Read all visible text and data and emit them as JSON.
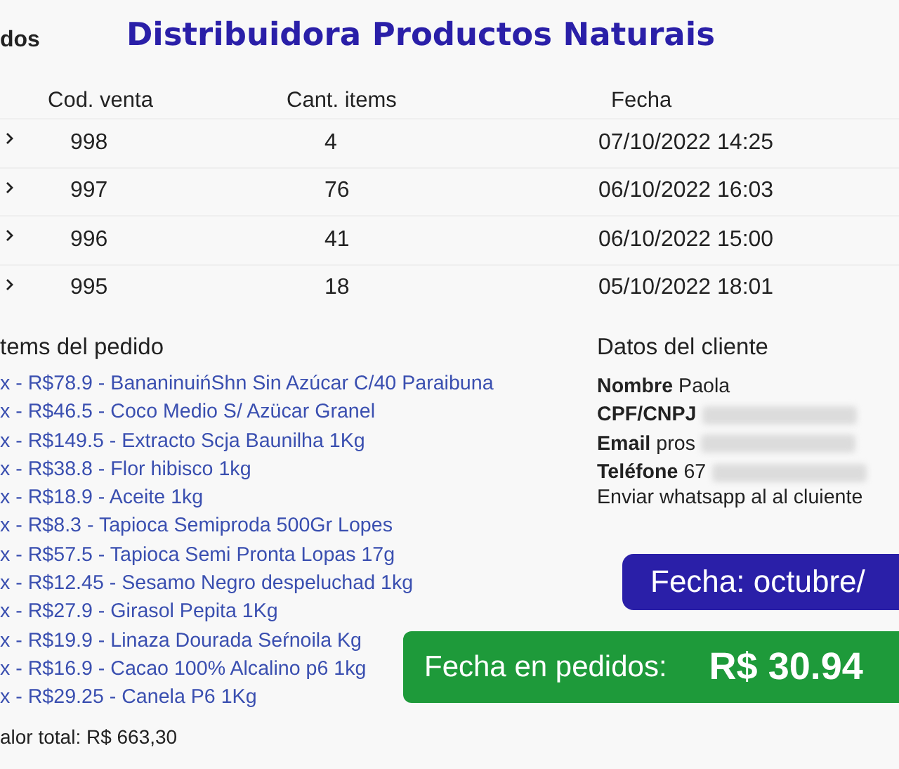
{
  "page_heading": "dos",
  "title": "Distribuidora Productos Naturais",
  "orders_table": {
    "columns": [
      "Cod. venta",
      "Cant. items",
      "Fecha"
    ],
    "rows": [
      {
        "code": "998",
        "items": "4",
        "date": "07/10/2022 14:25"
      },
      {
        "code": "997",
        "items": "76",
        "date": "06/10/2022 16:03"
      },
      {
        "code": "996",
        "items": "41",
        "date": "06/10/2022 15:00"
      },
      {
        "code": "995",
        "items": "18",
        "date": "05/10/2022 18:01"
      }
    ]
  },
  "order_items": {
    "heading": "tems del pedido",
    "items": [
      "x - R$78.9 - BananinuińShn Sin Azúcar C/40 Paraibuna",
      "x - R$46.5 - Coco Medio S/ Azücar Granel",
      "x - R$149.5 - Extracto Scja Baunilha 1Kg",
      "x - R$38.8 - Flor hibisco 1kg",
      "x - R$18.9 - Aceite 1kg",
      "x - R$8.3 - Tapioca Semiproda 500Gr Lopes",
      "x - R$57.5 - Tapioca Semi Pronta Lopas 17g",
      "x - R$12.45 - Sesamo Negro despeluchad 1kg",
      "x - R$27.9 - Girasol Pepita 1Kg",
      "x - R$19.9 - Linaza Dourada Seŕnoila Kg",
      "x - R$16.9 - Cacao 100% Alcalino p6 1kg",
      "x - R$29.25 - Canela P6 1Kg"
    ],
    "total": "alor total: R$ 663,30"
  },
  "client": {
    "heading": "Datos del cliente",
    "fields": [
      {
        "label": "Nombre",
        "value": "Paola",
        "blurred": false
      },
      {
        "label": "CPF/CNPJ",
        "blurred": true
      },
      {
        "label": "Email",
        "value": "pros",
        "blurred": true
      },
      {
        "label": "Teléfone",
        "value": "67",
        "blurred": true
      }
    ],
    "whatsapp_link": "Enviar whatsapp al al cluiente"
  },
  "date_banner": "Fecha: octubre/",
  "sales_banner": {
    "label": "Fecha en pedidos:",
    "amount": "R$ 30.94"
  }
}
